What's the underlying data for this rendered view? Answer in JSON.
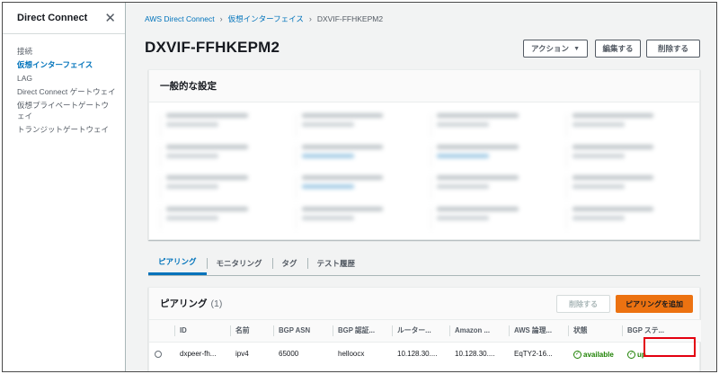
{
  "sidebar": {
    "title": "Direct Connect",
    "items": [
      {
        "label": "接続",
        "active": false
      },
      {
        "label": "仮想インターフェイス",
        "active": true
      },
      {
        "label": "LAG",
        "active": false
      },
      {
        "label": "Direct Connect ゲートウェイ",
        "active": false
      },
      {
        "label": "仮想プライベートゲートウェイ",
        "active": false
      },
      {
        "label": "トランジットゲートウェイ",
        "active": false
      }
    ]
  },
  "breadcrumb": [
    "AWS Direct Connect",
    "仮想インターフェイス",
    "DXVIF-FFHKEPM2"
  ],
  "page": {
    "title": "DXVIF-FFHKEPM2",
    "buttons": {
      "action": "アクション",
      "edit": "編集する",
      "delete": "削除する"
    }
  },
  "general": {
    "title": "一般的な設定"
  },
  "tabs": [
    {
      "label": "ピアリング",
      "active": true
    },
    {
      "label": "モニタリング",
      "active": false
    },
    {
      "label": "タグ",
      "active": false
    },
    {
      "label": "テスト履歴",
      "active": false
    }
  ],
  "peering": {
    "title": "ピアリング",
    "count": "(1)",
    "delete_label": "削除する",
    "add_label": "ピアリングを追加",
    "columns": [
      "ID",
      "名前",
      "BGP ASN",
      "BGP 認証...",
      "ルーター...",
      "Amazon ...",
      "AWS 論理...",
      "状態",
      "BGP ステ..."
    ],
    "rows": [
      {
        "id": "dxpeer-fh...",
        "name": "ipv4",
        "asn": "65000",
        "auth": "helloocx",
        "router": "10.128.30....",
        "amazon": "10.128.30....",
        "aws_logical": "EqTY2-16...",
        "state": "available",
        "bgp_status": "up"
      }
    ]
  },
  "colors": {
    "accent": "#0073bb",
    "primary_button": "#ec7211",
    "success": "#1d8102",
    "highlight": "#e3000f"
  }
}
